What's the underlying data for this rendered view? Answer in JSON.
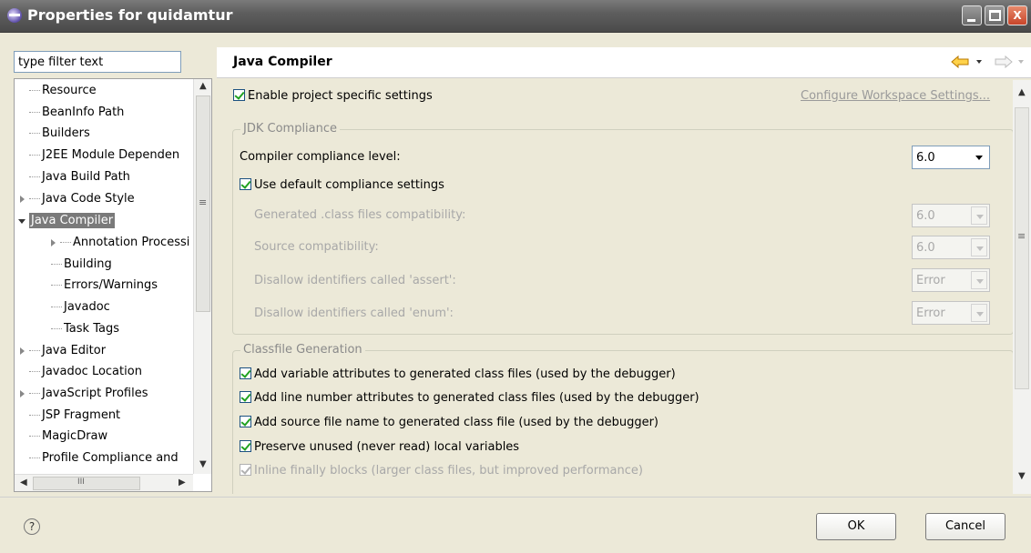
{
  "window": {
    "title": "Properties for quidamtur",
    "min_glyph": "_",
    "close_glyph": "X"
  },
  "filter": {
    "placeholder": "type filter text"
  },
  "tree": {
    "items": [
      {
        "label": "Resource"
      },
      {
        "label": "BeanInfo Path"
      },
      {
        "label": "Builders"
      },
      {
        "label": "J2EE Module Dependen"
      },
      {
        "label": "Java Build Path"
      },
      {
        "label": "Java Code Style"
      },
      {
        "label": "Java Compiler"
      },
      {
        "label": "Annotation Processi"
      },
      {
        "label": "Building"
      },
      {
        "label": "Errors/Warnings"
      },
      {
        "label": "Javadoc"
      },
      {
        "label": "Task Tags"
      },
      {
        "label": "Java Editor"
      },
      {
        "label": "Javadoc Location"
      },
      {
        "label": "JavaScript Profiles"
      },
      {
        "label": "JSP Fragment"
      },
      {
        "label": "MagicDraw"
      },
      {
        "label": "Profile Compliance and"
      }
    ],
    "scroll_grip": "≡",
    "hscroll_grip": "III"
  },
  "page": {
    "title": "Java Compiler",
    "enable_project": "Enable project specific settings",
    "configure_link": "Configure Workspace Settings...",
    "jdk_group": "JDK Compliance",
    "compliance_label": "Compiler compliance level:",
    "compliance_value": "6.0",
    "use_default": "Use default compliance settings",
    "generated_label": "Generated .class files compatibility:",
    "generated_value": "6.0",
    "source_label": "Source compatibility:",
    "source_value": "6.0",
    "assert_label": "Disallow identifiers called 'assert':",
    "assert_value": "Error",
    "enum_label": "Disallow identifiers called 'enum':",
    "enum_value": "Error",
    "classfile_group": "Classfile Generation",
    "opt_variable": "Add variable attributes to generated class files (used by the debugger)",
    "opt_line": "Add line number attributes to generated class files (used by the debugger)",
    "opt_source": "Add source file name to generated class file (used by the debugger)",
    "opt_preserve": "Preserve unused (never read) local variables",
    "opt_inline": "Inline finally blocks (larger class files, but improved performance)",
    "scroll_grip": "≡"
  },
  "buttons": {
    "ok": "OK",
    "cancel": "Cancel",
    "help": "?"
  },
  "colors": {
    "selection": "#7a7a7a",
    "check": "#21a121",
    "link_disabled": "#9a9a9a",
    "nav_arrow": "#e8a000"
  }
}
